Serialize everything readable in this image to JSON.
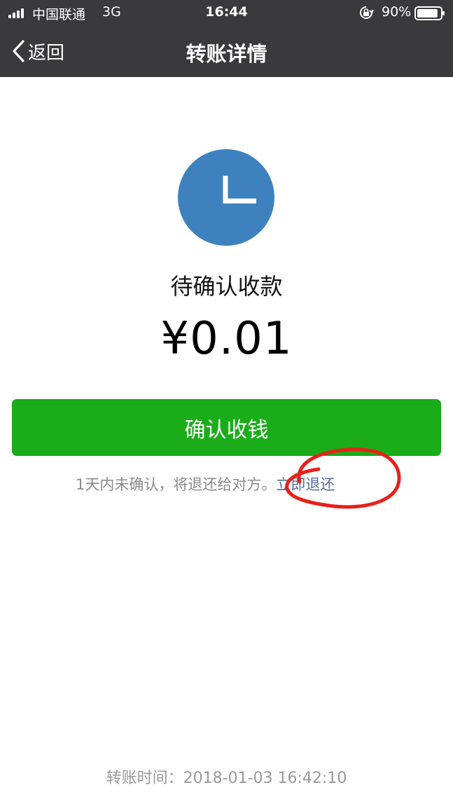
{
  "status_bar": {
    "carrier": "中国联通",
    "network": "3G",
    "time": "16:44",
    "battery": "90%",
    "battery_level": 0.9
  },
  "nav": {
    "back_label": "返回",
    "title": "转账详情"
  },
  "transfer": {
    "status": "待确认收款",
    "amount": "¥0.01",
    "confirm_label": "确认收钱",
    "notice": "1天内未确认，将退还给对方。",
    "refund_link": "立即退还",
    "time_label": "转账时间：",
    "time_value": "2018-01-03 16:42:10"
  },
  "colors": {
    "nav_bg": "#3a3a3c",
    "confirm_button": "#1aad19",
    "clock_circle": "#3d82bf",
    "link": "#576b95",
    "annotation": "#e8201a"
  }
}
